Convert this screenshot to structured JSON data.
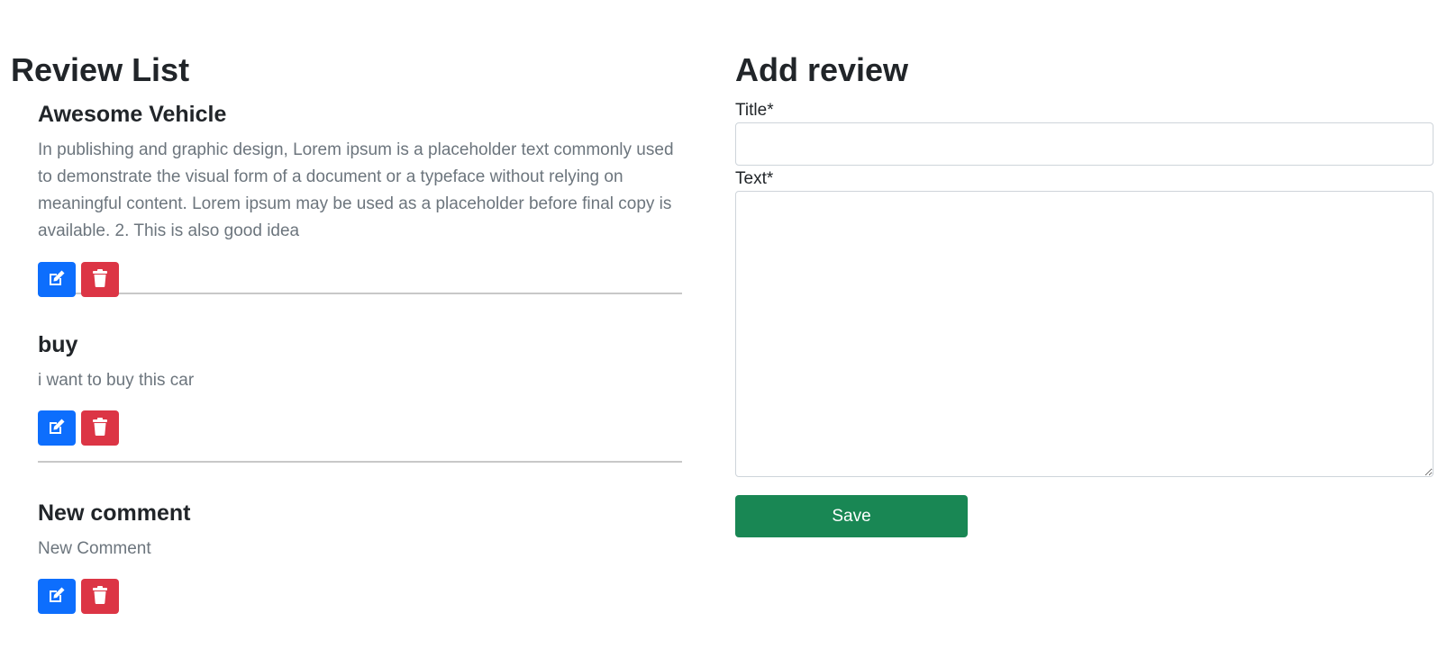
{
  "review_list": {
    "heading": "Review List",
    "reviews": [
      {
        "title": "Awesome Vehicle",
        "text": "In publishing and graphic design, Lorem ipsum is a placeholder text commonly used to demonstrate the visual form of a document or a typeface without relying on meaningful content. Lorem ipsum may be used as a placeholder before final copy is available. 2. This is also good idea",
        "edit_icon": "edit-icon",
        "delete_icon": "trash-icon"
      },
      {
        "title": "buy",
        "text": "i want to buy this car",
        "edit_icon": "edit-icon",
        "delete_icon": "trash-icon"
      },
      {
        "title": "New comment",
        "text": "New Comment",
        "edit_icon": "edit-icon",
        "delete_icon": "trash-icon"
      }
    ]
  },
  "add_review": {
    "heading": "Add review",
    "title_label": "Title*",
    "title_value": "",
    "text_label": "Text*",
    "text_value": "",
    "save_label": "Save"
  },
  "colors": {
    "edit_button": "#0d6efd",
    "delete_button": "#dc3545",
    "save_button": "#198754",
    "muted_text": "#6c757d"
  }
}
